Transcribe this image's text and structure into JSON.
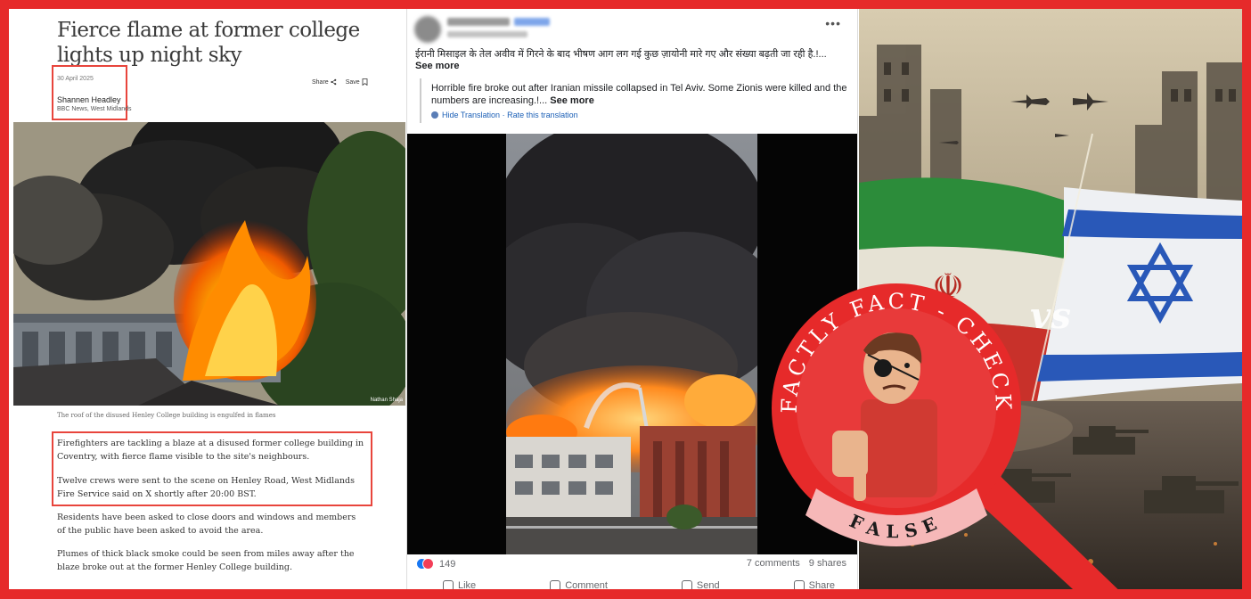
{
  "bbc_article": {
    "title": "Fierce flame at former college lights up night sky",
    "date": "30 April 2025",
    "author": "Shannen Headley",
    "organization": "BBC News, West Midlands",
    "share_label": "Share",
    "save_label": "Save",
    "photo_credit": "Nathan Shaja",
    "caption": "The roof of the disused Henley College building is engulfed in flames",
    "paragraphs": [
      "Firefighters are tackling a blaze at a disused former college building in Coventry, with fierce flame visible to the site's neighbours.",
      "Twelve crews were sent to the scene on Henley Road, West Midlands Fire Service said on X shortly after 20:00 BST.",
      "Residents have been asked to close doors and windows and members of the public have been asked to avoid the area.",
      "Plumes of thick black smoke could be seen from miles away after the blaze broke out at the former Henley College building."
    ]
  },
  "facebook_post": {
    "post_text": "ईरानी मिसाइल के तेल अवीव में गिरने के बाद भीषण आग लग गई कुछ ज़ायोनी मारे गए और संख्या बढ़ती जा रही है.!...",
    "see_more_label": "See more",
    "translation_text": "Horrible fire broke out after Iranian missile collapsed in Tel Aviv. Some Zionis were killed and the numbers are increasing.!...",
    "translation_see_more": "See more",
    "hide_translation_label": "Hide Translation",
    "rate_translation_label": "Rate this translation",
    "separator": "·",
    "reaction_count": "149",
    "comments_label": "7 comments",
    "shares_label": "9 shares",
    "actions": [
      "Like",
      "Comment",
      "Send",
      "Share"
    ],
    "more_icon": "more-options-icon"
  },
  "badge": {
    "arc_text": "FACTLY FACT - CHECK",
    "verdict": "FALSE",
    "colors": {
      "ring": "#e62a2a",
      "ribbon": "#f6b8b8",
      "frame": "#e62a2a"
    }
  },
  "art": {
    "vs_text": "vs"
  }
}
